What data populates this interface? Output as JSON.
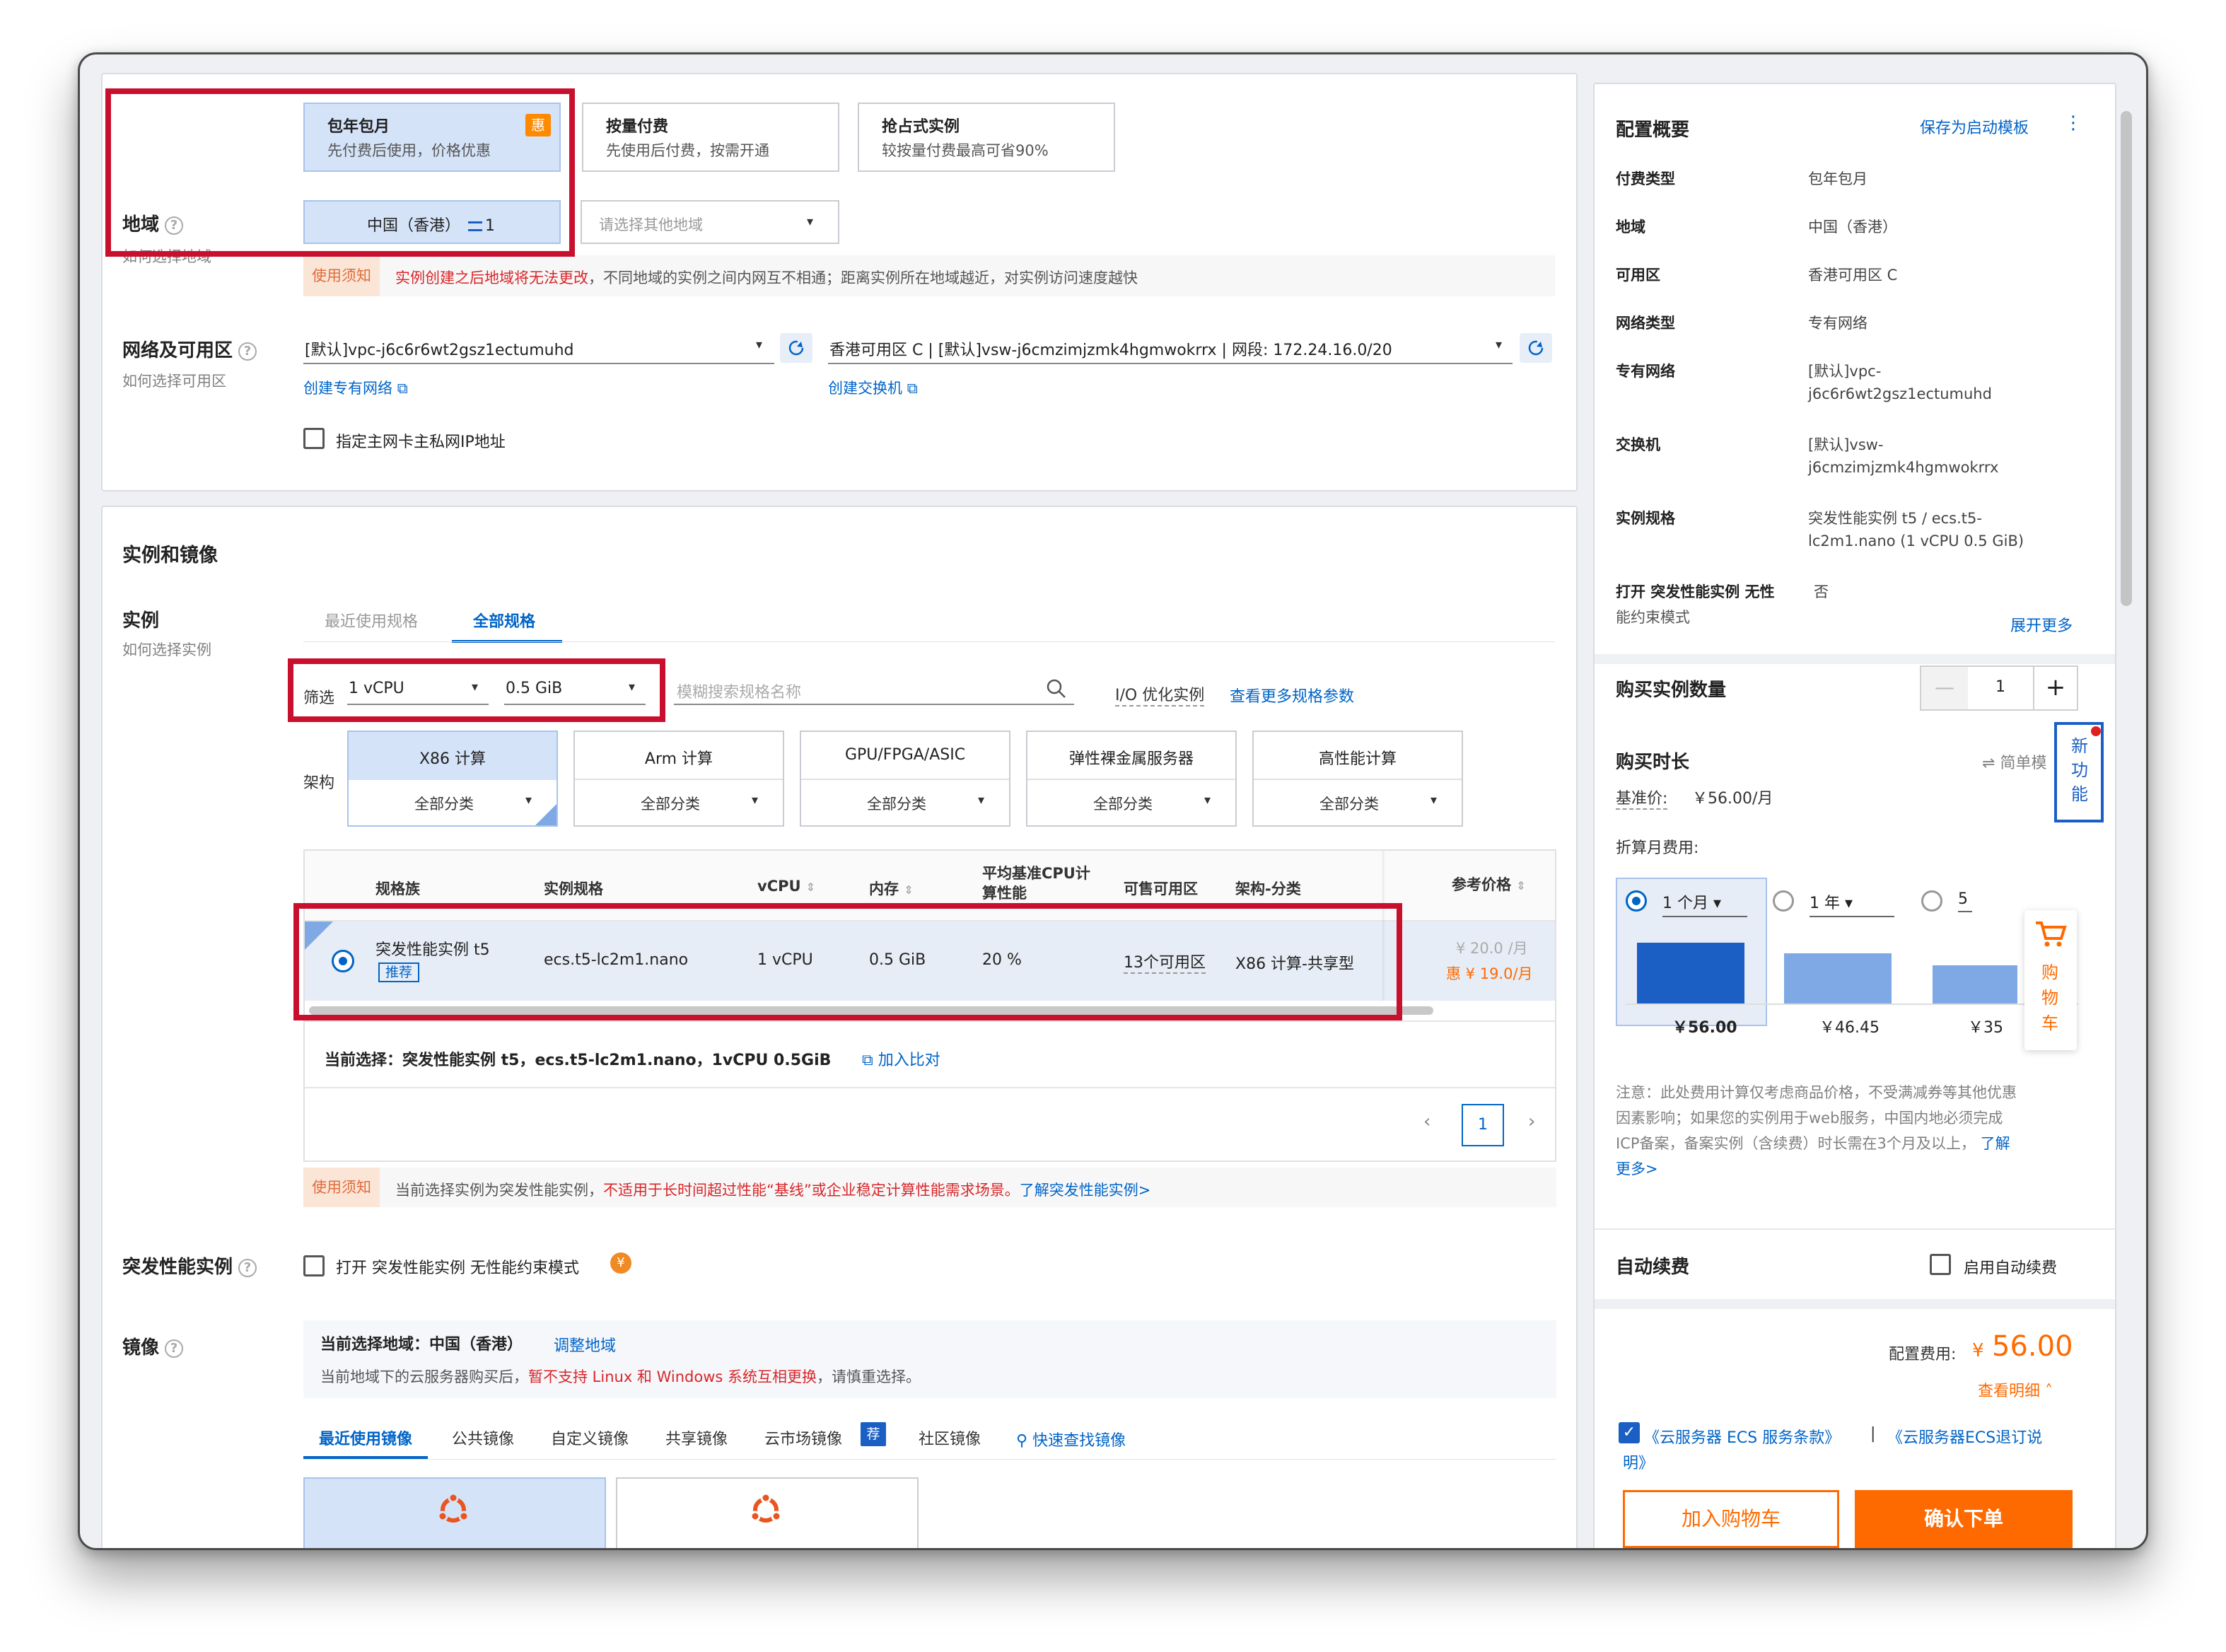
{
  "billing": {
    "options": [
      {
        "title": "包年包月",
        "desc": "先付费后使用，价格优惠",
        "badge": "惠"
      },
      {
        "title": "按量付费",
        "desc": "先使用后付费，按需开通"
      },
      {
        "title": "抢占式实例",
        "desc": "较按量付费最高可省90%"
      }
    ]
  },
  "region": {
    "label": "地域",
    "help": "如何选择地域",
    "selected": "中国（香港）",
    "count": "1",
    "other_placeholder": "请选择其他地域",
    "notice_tag": "使用须知",
    "notice_red": "实例创建之后地域将无法更改",
    "notice_rest": "，不同地域的实例之间内网互不相通；距离实例所在地域越近，对实例访问速度越快"
  },
  "network": {
    "label": "网络及可用区",
    "help": "如何选择可用区",
    "vpc": "[默认]vpc-j6c6r6wt2gsz1ectumuhd",
    "vswitch": "香港可用区 C | [默认]vsw-j6cmzimjzmk4hgmwokrrx | 网段: 172.24.16.0/20",
    "create_vpc": "创建专有网络",
    "create_vsw": "创建交换机",
    "private_ip": "指定主网卡主私网IP地址"
  },
  "instance": {
    "section_title": "实例和镜像",
    "label": "实例",
    "help": "如何选择实例",
    "tabs": [
      "最近使用规格",
      "全部规格"
    ],
    "filter_label": "筛选",
    "vcpu": "1 vCPU",
    "mem": "0.5 GiB",
    "search_placeholder": "模糊搜索规格名称",
    "io_opt": "I/O 优化实例",
    "more_params": "查看更多规格参数",
    "arch_label": "架构",
    "arch": [
      {
        "name": "X86 计算",
        "sub": "全部分类"
      },
      {
        "name": "Arm 计算",
        "sub": "全部分类"
      },
      {
        "name": "GPU/FPGA/ASIC",
        "sub": "全部分类"
      },
      {
        "name": "弹性裸金属服务器",
        "sub": "全部分类"
      },
      {
        "name": "高性能计算",
        "sub": "全部分类"
      }
    ],
    "columns": [
      "规格族",
      "实例规格",
      "vCPU",
      "内存",
      "平均基准CPU计算性能",
      "可售可用区",
      "架构-分类",
      "参考价格"
    ],
    "row": {
      "family": "突发性能实例 t5",
      "tag": "推荐",
      "spec": "ecs.t5-lc2m1.nano",
      "vcpu": "1 vCPU",
      "mem": "0.5 GiB",
      "cpu_perf": "20 %",
      "zones": "13个可用区",
      "arch": "X86 计算-共享型",
      "price": "¥ 20.0 /月",
      "price_disc": "惠 ¥ 19.0/月"
    },
    "current": "当前选择：突发性能实例 t5，ecs.t5-lc2m1.nano，1vCPU 0.5GiB",
    "compare": "加入比对",
    "page": "1",
    "notice_tag": "使用须知",
    "notice_a": "当前选择实例为突发性能实例，",
    "notice_red": "不适用于长时间超过性能“基线”或企业稳定计算性能需求场景。",
    "notice_link": "了解突发性能实例>"
  },
  "burst": {
    "label": "突发性能实例",
    "check": "打开 突发性能实例 无性能约束模式"
  },
  "image": {
    "label": "镜像",
    "region_line": "当前选择地域：中国（香港）",
    "adjust": "调整地域",
    "warn_a": "当前地域下的云服务器购买后，",
    "warn_red": "暂不支持 Linux 和 Windows 系统互相更换",
    "warn_b": "，请慎重选择。",
    "tabs": [
      "最近使用镜像",
      "公共镜像",
      "自定义镜像",
      "共享镜像",
      "云市场镜像",
      "社区镜像"
    ],
    "market_badge": "荐",
    "quick": "快速查找镜像"
  },
  "summary": {
    "title": "配置概要",
    "save": "保存为启动模板",
    "rows": [
      {
        "k": "付费类型",
        "v": "包年包月"
      },
      {
        "k": "地域",
        "v": "中国（香港）"
      },
      {
        "k": "可用区",
        "v": "香港可用区 C"
      },
      {
        "k": "网络类型",
        "v": "专有网络"
      },
      {
        "k": "专有网络",
        "v": "[默认]vpc-",
        "v2": "j6c6r6wt2gsz1ectumuhd"
      },
      {
        "k": "交换机",
        "v": "[默认]vsw-",
        "v2": "j6cmzimjzmk4hgmwokrrx"
      },
      {
        "k": "实例规格",
        "v": "突发性能实例 t5 / ecs.t5-",
        "v2": "lc2m1.nano (1 vCPU 0.5 GiB)"
      },
      {
        "k": "打开 突发性能实例 无性",
        "k2": "能约束模式",
        "v": "否"
      }
    ],
    "expand": "展开更多"
  },
  "purchase": {
    "qty_label": "购买实例数量",
    "qty": "1",
    "dur_label": "购买时长",
    "simple": "简单模",
    "base_label": "基准价:",
    "base_price": "￥56.00/月",
    "monthly_label": "折算月费用:",
    "durations": [
      {
        "label": "1 个月",
        "price": "￥56.00",
        "fill": 1.0
      },
      {
        "label": "1 年",
        "price": "￥46.45",
        "fill": 0.83
      },
      {
        "label": "5",
        "price": "￥35",
        "fill": 0.63
      }
    ],
    "note": [
      "注意：此处费用计算仅考虑商品价格，不受满减券等其他优惠",
      "因素影响；如果您的实例用于web服务，中国内地必须完成",
      "ICP备案，备案实例（含续费）时长需在3个月及以上，"
    ],
    "note_link": "了解",
    "note_link2": "更多>",
    "auto_label": "自动续费",
    "auto_check": "启用自动续费",
    "fee_label": "配置费用:",
    "fee_currency": "¥",
    "fee": "56.00",
    "detail": "查看明细",
    "terms_a": "《云服务器 ECS 服务条款》",
    "terms_sep": "|",
    "terms_b": "《云服务器ECS退订说",
    "terms_b2": "明》",
    "cart_btn": "加入购物车",
    "order_btn": "确认下单",
    "new_feature": [
      "新",
      "功",
      "能"
    ],
    "cart_side": [
      "购",
      "物",
      "车"
    ]
  },
  "colors": {
    "accent": "#0064c8",
    "orange": "#ff6a00",
    "red_box": "#c8102e",
    "bar": "#1b5fc4",
    "bar_light": "#7ea9e4"
  }
}
